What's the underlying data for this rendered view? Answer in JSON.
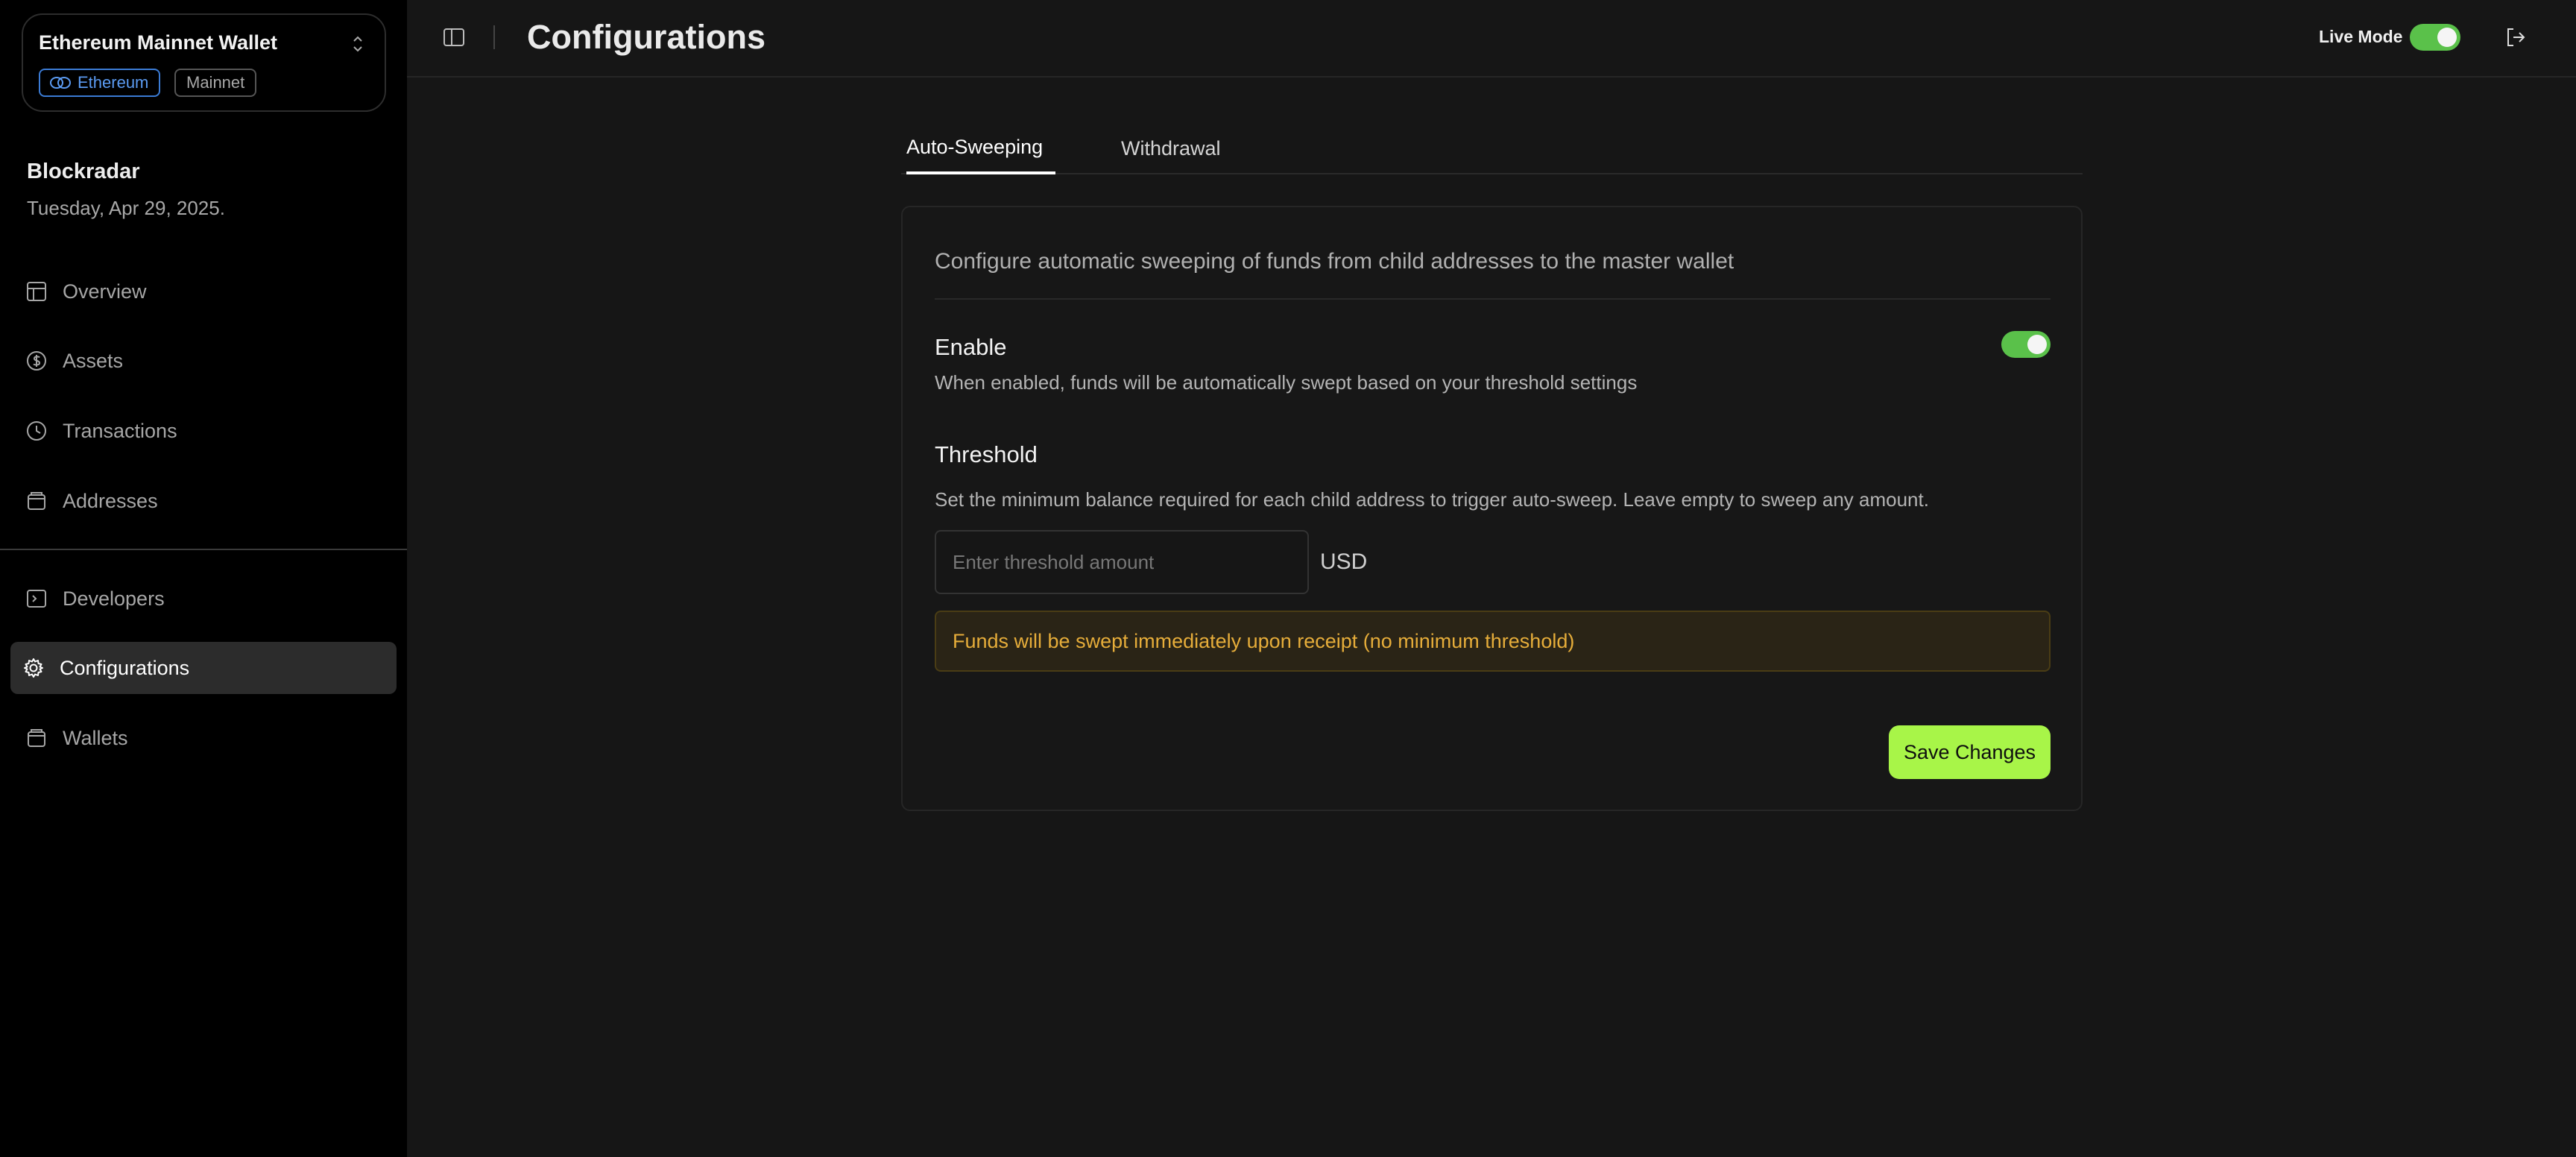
{
  "wallet": {
    "name": "Ethereum Mainnet Wallet",
    "chain_chip": "Ethereum",
    "network_chip": "Mainnet"
  },
  "org": {
    "name": "Blockradar",
    "date": "Tuesday, Apr 29, 2025."
  },
  "sidebar": {
    "items": [
      {
        "label": "Overview",
        "icon": "layout-icon"
      },
      {
        "label": "Assets",
        "icon": "dollar-circle-icon"
      },
      {
        "label": "Transactions",
        "icon": "clock-icon"
      },
      {
        "label": "Addresses",
        "icon": "wallet-icon"
      },
      {
        "label": "Developers",
        "icon": "terminal-icon"
      },
      {
        "label": "Configurations",
        "icon": "gear-icon",
        "active": true
      },
      {
        "label": "Wallets",
        "icon": "wallet-icon"
      }
    ]
  },
  "header": {
    "title": "Configurations",
    "live_mode_label": "Live Mode",
    "live_mode_on": true
  },
  "tabs": [
    {
      "label": "Auto-Sweeping",
      "active": true
    },
    {
      "label": "Withdrawal",
      "active": false
    }
  ],
  "card": {
    "description": "Configure automatic sweeping of funds from child addresses to the master wallet",
    "enable_title": "Enable",
    "enable_desc": "When enabled, funds will be automatically swept based on your threshold settings",
    "enable_on": true,
    "threshold_title": "Threshold",
    "threshold_desc": "Set the minimum balance required for each child address to trigger auto-sweep. Leave empty to sweep any amount.",
    "threshold_placeholder": "Enter threshold amount",
    "threshold_value": "",
    "currency": "USD",
    "notice": "Funds will be swept immediately upon receipt (no minimum threshold)",
    "save_label": "Save Changes"
  },
  "colors": {
    "accent_green": "#a8f548",
    "toggle_green": "#5ac14a",
    "notice_text": "#e6ad3a",
    "chain_blue": "#5b9bf2"
  }
}
